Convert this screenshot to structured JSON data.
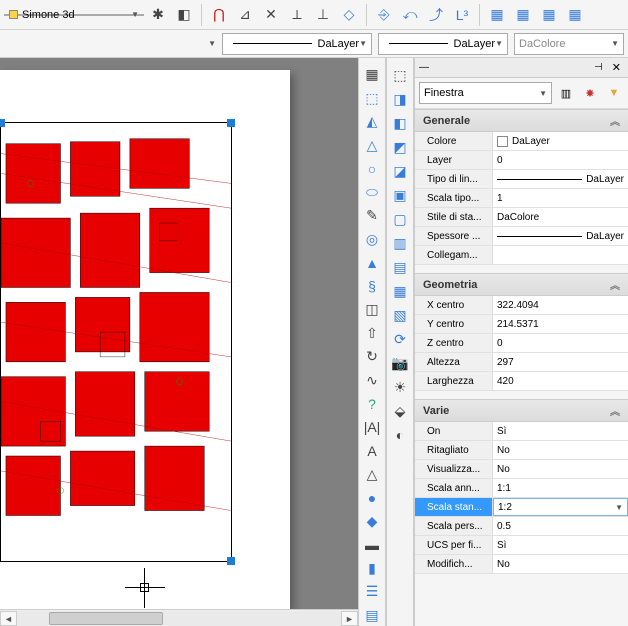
{
  "toolbar": {
    "layer_combo": "Simone 3d",
    "linetype1": "DaLayer",
    "linetype2": "DaLayer",
    "color_combo": "DaColore"
  },
  "properties": {
    "object_type": "Finestra",
    "sections": {
      "general": {
        "title": "Generale",
        "colore_label": "Colore",
        "colore_value": "DaLayer",
        "layer_label": "Layer",
        "layer_value": "0",
        "tipolinea_label": "Tipo di lin...",
        "tipolinea_value": "DaLayer",
        "scalatipo_label": "Scala tipo...",
        "scalatipo_value": "1",
        "stilestampa_label": "Stile di sta...",
        "stilestampa_value": "DaColore",
        "spessore_label": "Spessore ...",
        "spessore_value": "DaLayer",
        "collegam_label": "Collegam...",
        "collegam_value": ""
      },
      "geometria": {
        "title": "Geometria",
        "xcentro_label": "X centro",
        "xcentro_value": "322.4094",
        "ycentro_label": "Y centro",
        "ycentro_value": "214.5371",
        "zcentro_label": "Z centro",
        "zcentro_value": "0",
        "altezza_label": "Altezza",
        "altezza_value": "297",
        "larghezza_label": "Larghezza",
        "larghezza_value": "420"
      },
      "varie": {
        "title": "Varie",
        "on_label": "On",
        "on_value": "Sì",
        "ritagliato_label": "Ritagliato",
        "ritagliato_value": "No",
        "visualizza_label": "Visualizza...",
        "visualizza_value": "No",
        "scalaann_label": "Scala ann...",
        "scalaann_value": "1:1",
        "scalastand_label": "Scala stan...",
        "scalastand_value": "1:2",
        "scalapers_label": "Scala pers...",
        "scalapers_value": "0.5",
        "ucsperfi_label": "UCS per fi...",
        "ucsperfi_value": "Sì",
        "modifich_label": "Modifich...",
        "modifich_value": "No"
      }
    }
  }
}
